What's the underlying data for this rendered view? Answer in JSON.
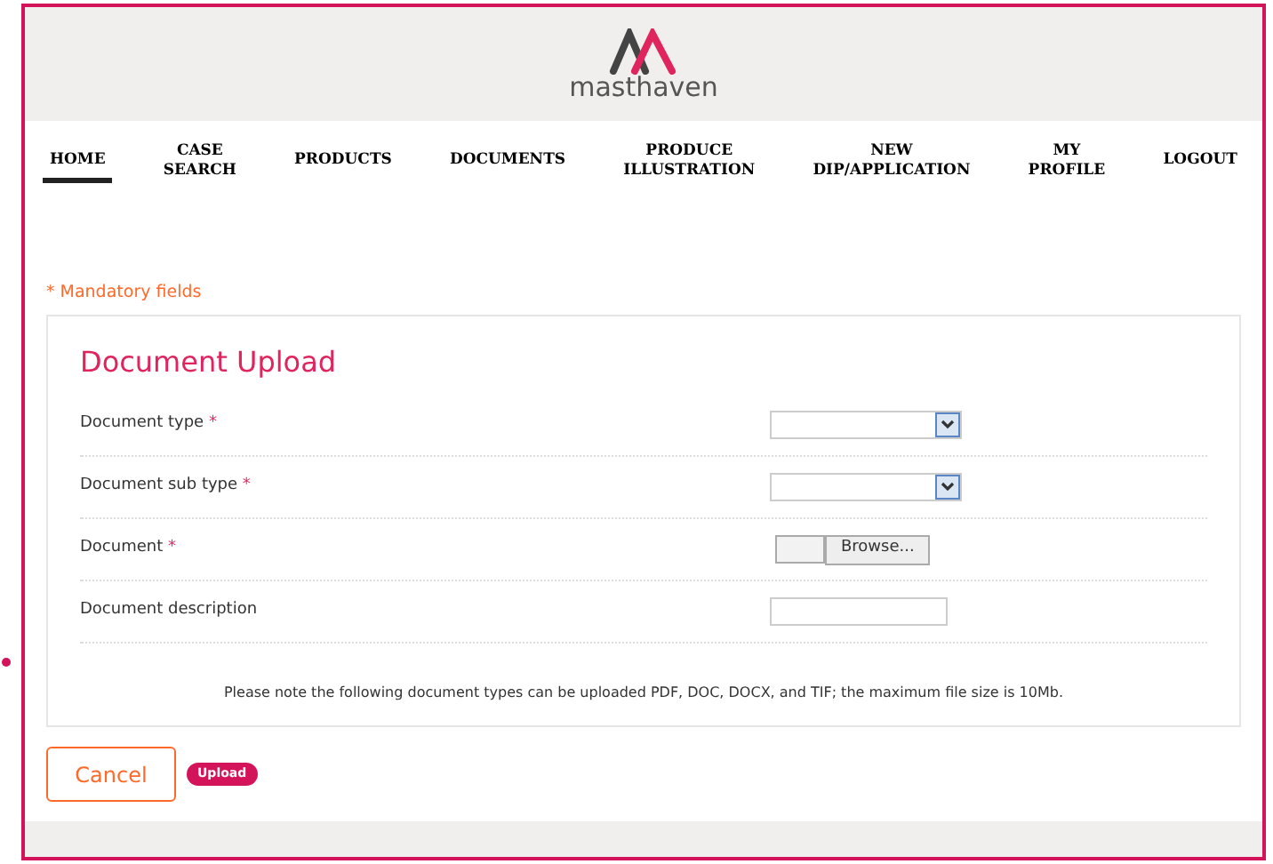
{
  "header": {
    "logo_text": "masthaven"
  },
  "nav": [
    {
      "label": "HOME",
      "selected": true
    },
    {
      "label": "CASE\nSEARCH",
      "selected": false
    },
    {
      "label": "PRODUCTS",
      "selected": false
    },
    {
      "label": "DOCUMENTS",
      "selected": false
    },
    {
      "label": "PRODUCE\nILLUSTRATION",
      "selected": false
    },
    {
      "label": "NEW\nDIP/APPLICATION",
      "selected": false
    },
    {
      "label": "MY\nPROFILE",
      "selected": false
    },
    {
      "label": "LOGOUT",
      "selected": false
    }
  ],
  "mandatory_note": "* Mandatory fields",
  "form": {
    "title": "Document Upload",
    "fields": [
      {
        "label": "Document type",
        "required_mark": "*",
        "kind": "select"
      },
      {
        "label": "Document sub type",
        "required_mark": "*",
        "kind": "select"
      },
      {
        "label": "Document",
        "required_mark": "*",
        "kind": "file",
        "button": "Browse..."
      },
      {
        "label": "Document description",
        "kind": "text"
      }
    ],
    "note": "Please note the following document types can be uploaded PDF, DOC, DOCX, and TIF; the maximum file size is 10Mb."
  },
  "buttons": {
    "cancel": "Cancel",
    "upload": "Upload"
  }
}
